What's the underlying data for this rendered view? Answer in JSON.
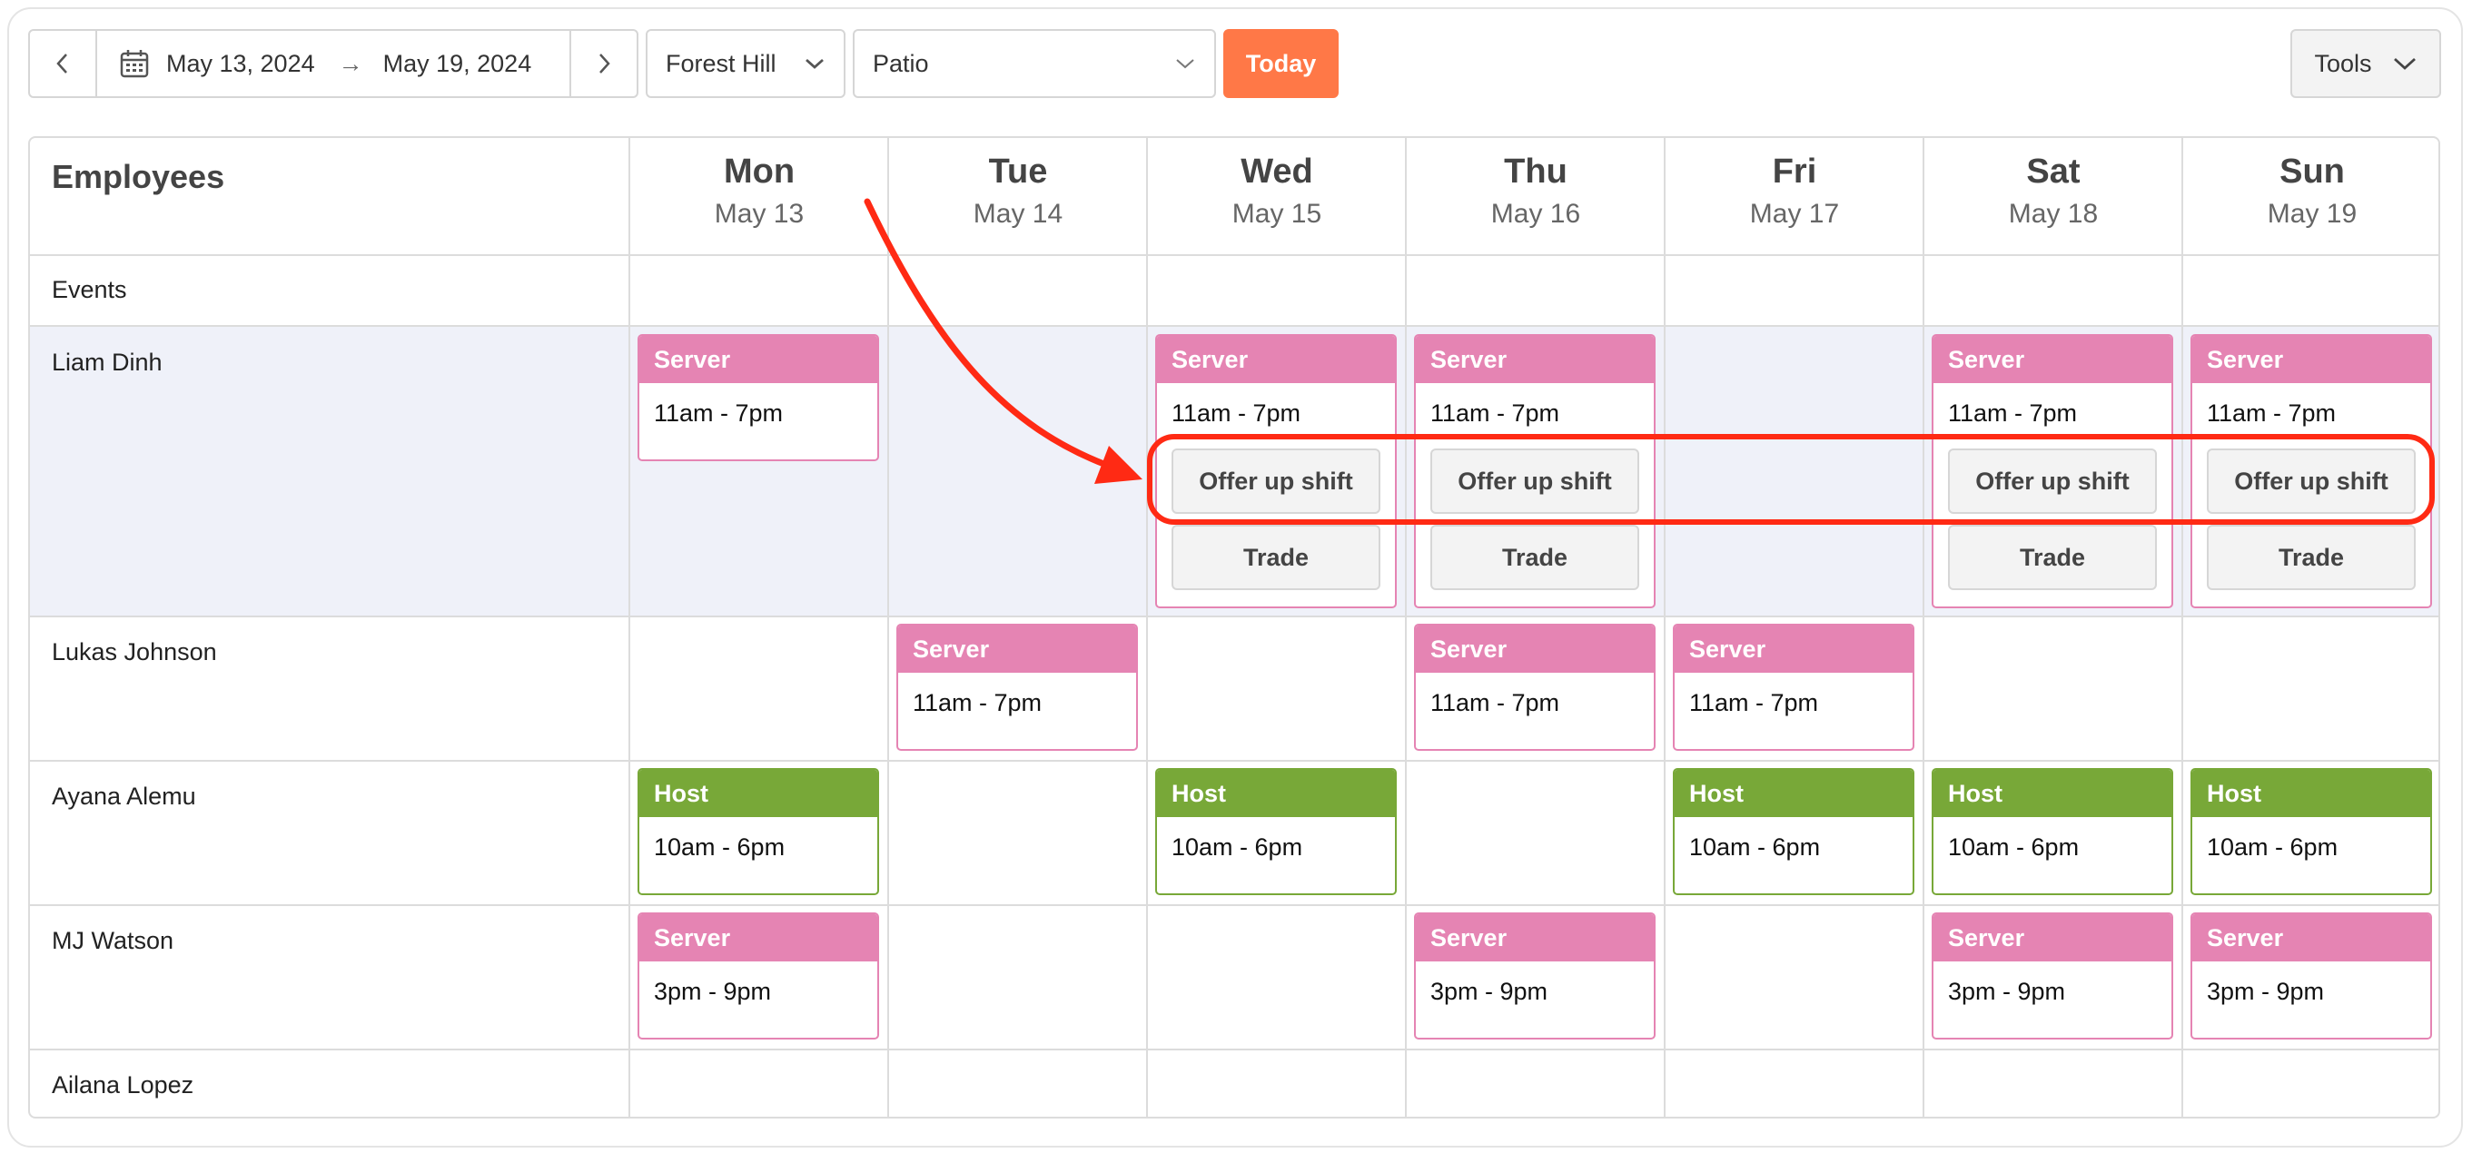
{
  "toolbar": {
    "start_date": "May 13, 2024",
    "end_date": "May 19, 2024",
    "location": "Forest Hill",
    "area": "Patio",
    "today_label": "Today",
    "tools_label": "Tools"
  },
  "colors": {
    "server": "#e584b3",
    "host": "#78a838",
    "accent": "#ff7847",
    "annotation": "#ff2a14"
  },
  "grid": {
    "employees_header": "Employees",
    "events_label": "Events",
    "days": [
      {
        "name": "Mon",
        "date": "May 13"
      },
      {
        "name": "Tue",
        "date": "May 14"
      },
      {
        "name": "Wed",
        "date": "May 15"
      },
      {
        "name": "Thu",
        "date": "May 16"
      },
      {
        "name": "Fri",
        "date": "May 17"
      },
      {
        "name": "Sat",
        "date": "May 18"
      },
      {
        "name": "Sun",
        "date": "May 19"
      }
    ],
    "employees": [
      {
        "name": "Liam Dinh"
      },
      {
        "name": "Lukas Johnson"
      },
      {
        "name": "Ayana Alemu"
      },
      {
        "name": "MJ Watson"
      },
      {
        "name": "Ailana Lopez"
      }
    ]
  },
  "shifts": {
    "server_role": "Server",
    "host_role": "Host",
    "t_11_7": "11am - 7pm",
    "t_10_6": "10am - 6pm",
    "t_3_9": "3pm - 9pm",
    "offer_label": "Offer up shift",
    "trade_label": "Trade"
  }
}
